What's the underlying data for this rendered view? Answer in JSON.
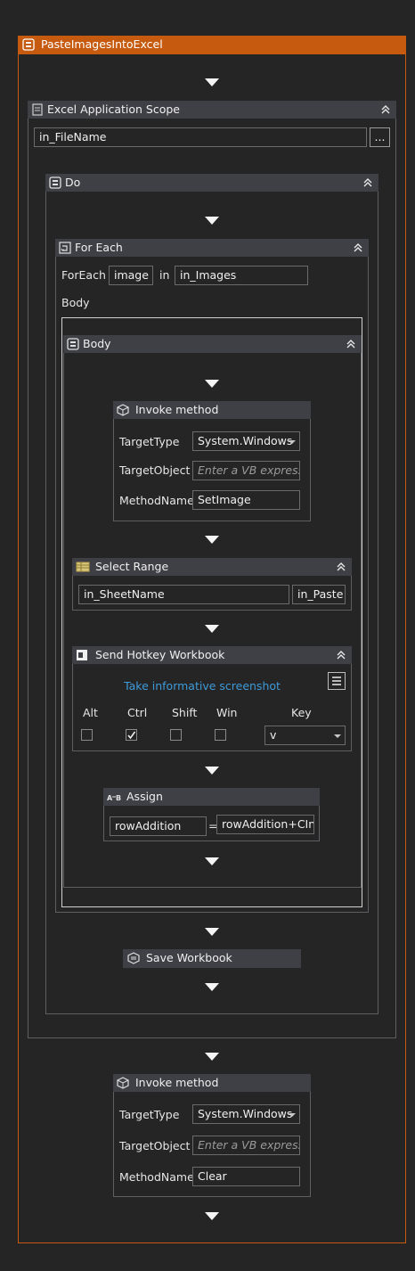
{
  "sequence": {
    "title": "PasteImagesIntoExcel"
  },
  "excel_scope": {
    "title": "Excel Application Scope",
    "file_value": "in_FileName",
    "browse_label": "..."
  },
  "do_block": {
    "title": "Do"
  },
  "for_each": {
    "title": "For Each",
    "foreach_label": "ForEach",
    "item_value": "image",
    "in_label": "in",
    "collection_value": "in_Images",
    "body_label": "Body"
  },
  "body_seq": {
    "title": "Body"
  },
  "invoke1": {
    "title": "Invoke method",
    "target_type_label": "TargetType",
    "target_type_value": "System.Windows",
    "target_object_label": "TargetObject",
    "target_object_placeholder": "Enter a VB express",
    "method_name_label": "MethodName",
    "method_name_value": "SetImage"
  },
  "select_range": {
    "title": "Select Range",
    "sheet_value": "in_SheetName",
    "range_value": "in_Paste"
  },
  "send_hotkey": {
    "title": "Send Hotkey Workbook",
    "screenshot_link": "Take informative screenshot",
    "alt_label": "Alt",
    "ctrl_label": "Ctrl",
    "shift_label": "Shift",
    "win_label": "Win",
    "key_label": "Key",
    "alt_checked": false,
    "ctrl_checked": true,
    "shift_checked": false,
    "win_checked": false,
    "key_value": "v"
  },
  "assign": {
    "title": "Assign",
    "to_value": "rowAddition",
    "eq": "=",
    "value": "rowAddition+CIn"
  },
  "save_workbook": {
    "title": "Save Workbook"
  },
  "invoke2": {
    "title": "Invoke method",
    "target_type_label": "TargetType",
    "target_type_value": "System.Windows",
    "target_object_label": "TargetObject",
    "target_object_placeholder": "Enter a VB express",
    "method_name_label": "MethodName",
    "method_name_value": "Clear"
  },
  "colors": {
    "sequence_header": "#c65a0e",
    "panel": "#252526",
    "header": "#3f3f46",
    "link": "#3f9ad8"
  }
}
